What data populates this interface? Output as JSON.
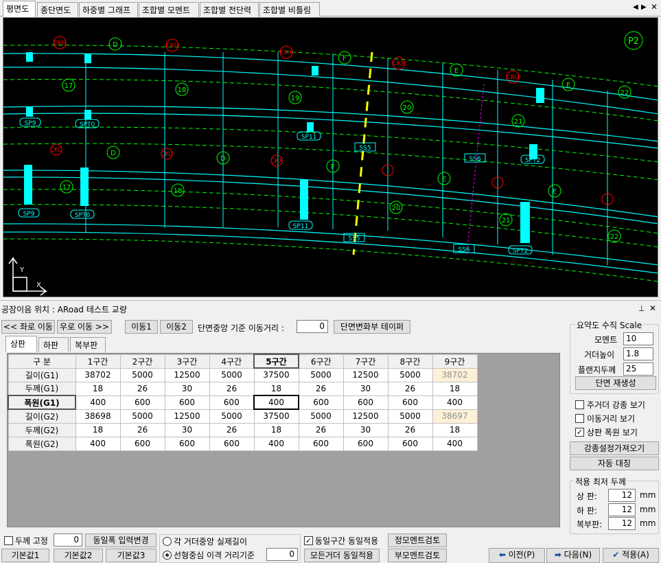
{
  "tabs": [
    "평면도",
    "종단면도",
    "하중별 그래프",
    "조합별 모멘트",
    "조합별 전단력",
    "조합별 비틀림"
  ],
  "canvas_labels": {
    "p2": "P2",
    "cku": "CKU",
    "d": "D",
    "ckx": "CKX",
    "f": "F",
    "e": "E",
    "sp9": "SP9",
    "spt0": "SPT0",
    "sp11": "SP11",
    "ss5": "SS5",
    "ss6": "SS6",
    "spt2": "SPT2",
    "n17": "17",
    "n18": "18",
    "n19": "19",
    "n20": "20",
    "n21": "21",
    "n22": "22",
    "axis_y": "Y",
    "axis_x": "X"
  },
  "panel_title": "공장이음 위치 : ARoad 테스트 교량",
  "nav": {
    "left": "<< 좌로 이동",
    "right": "우로 이동 >>",
    "move1": "이동1",
    "move2": "이동2",
    "distance_label": "단면중앙 기준 이동거리 :",
    "distance_value": "0",
    "taper": "단면변화부 테이퍼"
  },
  "subtabs": [
    "상판",
    "하판",
    "복부판"
  ],
  "grid": {
    "corner": "구 분",
    "columns": [
      "1구간",
      "2구간",
      "3구간",
      "4구간",
      "5구간",
      "6구간",
      "7구간",
      "8구간",
      "9구간"
    ],
    "rows": [
      {
        "label": "길이(G1)",
        "cells": [
          "38702",
          "5000",
          "12500",
          "5000",
          "37500",
          "5000",
          "12500",
          "5000",
          "38702"
        ]
      },
      {
        "label": "두께(G1)",
        "cells": [
          "18",
          "26",
          "30",
          "26",
          "18",
          "26",
          "30",
          "26",
          "18"
        ]
      },
      {
        "label": "폭원(G1)",
        "cells": [
          "400",
          "600",
          "600",
          "600",
          "400",
          "600",
          "600",
          "600",
          "400"
        ]
      },
      {
        "label": "길이(G2)",
        "cells": [
          "38698",
          "5000",
          "12500",
          "5000",
          "37500",
          "5000",
          "12500",
          "5000",
          "38697"
        ]
      },
      {
        "label": "두께(G2)",
        "cells": [
          "18",
          "26",
          "30",
          "26",
          "18",
          "26",
          "30",
          "26",
          "18"
        ]
      },
      {
        "label": "폭원(G2)",
        "cells": [
          "400",
          "600",
          "600",
          "600",
          "400",
          "600",
          "600",
          "600",
          "400"
        ]
      }
    ]
  },
  "scale": {
    "title": "요약도 수직 Scale",
    "moment_label": "모멘트",
    "moment_value": "10",
    "girder_label": "거더높이",
    "girder_value": "1.8",
    "flange_label": "플랜지두께",
    "flange_value": "25",
    "regen": "단면 재생성"
  },
  "options": {
    "main_girder": "주거더 강종 보기",
    "move_dist": "이동거리 보기",
    "top_width": "상판 폭원 보기",
    "import_steel": "강종설정가져오기",
    "auto_sym": "자동 대칭"
  },
  "min_thk": {
    "title": "적용 최저 두께",
    "top_label": "상    판:",
    "top_value": "12",
    "bot_label": "하    판:",
    "bot_value": "12",
    "web_label": "복부판:",
    "web_value": "12",
    "unit": "mm"
  },
  "bottom": {
    "fix_thk": "두께 고정",
    "fix_value": "0",
    "same_width": "동일폭 입력변경",
    "def1": "기본값1",
    "def2": "기본값2",
    "def3": "기본값3",
    "radio1": "각 거더중앙 실제길이",
    "radio2": "선형중심 이격 거리기준",
    "radio_value": "0",
    "same_section": "동일구간 동일적용",
    "all_girder": "모든거더 동일적용",
    "pos_moment": "정모멘트검토",
    "neg_moment": "부모멘트검토",
    "prev": "이전(P)",
    "next": "다음(N)",
    "apply": "적용(A)"
  },
  "colors": {
    "canvas_bg": "#000000",
    "line_cyan": "#00ffff",
    "line_green": "#00ff00",
    "line_red": "#ff0000",
    "line_yellow": "#ffff00",
    "highlight_cell": "#fdf0d8"
  }
}
